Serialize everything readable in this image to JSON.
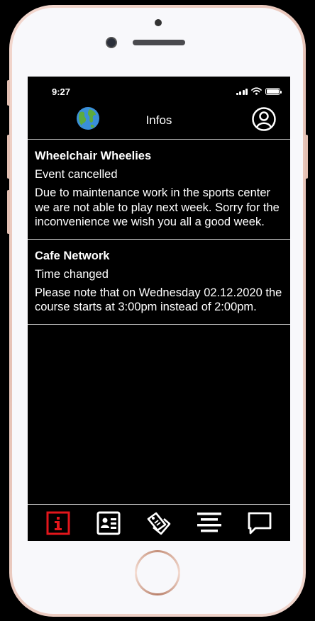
{
  "status_bar": {
    "time": "9:27"
  },
  "header": {
    "title": "Infos",
    "left_icon": "globe-icon",
    "right_icon": "account-circle-icon"
  },
  "feed": {
    "items": [
      {
        "title": "Wheelchair Wheelies",
        "subtitle": "Event cancelled",
        "body": "Due to maintenance work in the sports center we are not able to play next week. Sorry for the inconvenience we wish you all a good week."
      },
      {
        "title": "Cafe Network",
        "subtitle": "Time changed",
        "body": "Please note that on Wednesday 02.12.2020 the course starts at 3:00pm instead of 2:00pm."
      }
    ]
  },
  "tab_bar": {
    "tabs": [
      {
        "icon": "info-icon",
        "active": true
      },
      {
        "icon": "contact-card-icon",
        "active": false
      },
      {
        "icon": "tags-icon",
        "active": false
      },
      {
        "icon": "menu-lines-icon",
        "active": false
      },
      {
        "icon": "chat-bubble-icon",
        "active": false
      }
    ]
  },
  "colors": {
    "active_tab": "#e3161b",
    "background": "#000000",
    "text": "#ffffff",
    "divider": "#bfbfbf"
  }
}
